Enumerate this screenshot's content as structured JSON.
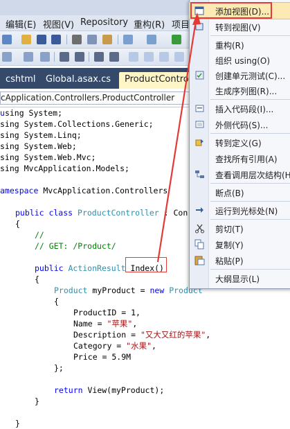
{
  "menubar": {
    "items": [
      "编辑(E)",
      "视图(V)",
      "Repository",
      "重构(R)",
      "项目"
    ]
  },
  "tabs": {
    "items": [
      {
        "label": "cshtml",
        "active": false
      },
      {
        "label": "Global.asax.cs",
        "active": false
      },
      {
        "label": "ProductControlle",
        "active": true
      }
    ]
  },
  "navbar": {
    "type_combo": "cApplication.Controllers.ProductController"
  },
  "code": {
    "usings": [
      "sing System;",
      "sing System.Collections.Generic;",
      "sing System.Linq;",
      "sing System.Web;",
      "sing System.Web.Mvc;",
      "sing MvcApplication.Models;"
    ],
    "ns_kw": "amespace",
    "ns_name": " MvcApplication.Controllers",
    "class_kw": "public class",
    "class_name": "ProductController",
    "class_rest": " : Con",
    "brace_open": "{",
    "brace_close": "}",
    "comment1": "//",
    "comment2": "// GET: /Product/",
    "method_kw": "public",
    "method_type": "ActionResult",
    "method_name": "Index()",
    "product_type": "Product",
    "var_decl": " myProduct = ",
    "new_kw": "new",
    "product_type2": " Product",
    "prop_id": "ProductID = 1,",
    "prop_name_lead": "Name = ",
    "prop_name_val": "\"苹果\"",
    "prop_name_tail": ",",
    "prop_desc_lead": "Description = ",
    "prop_desc_val": "\"又大又红的苹果\"",
    "prop_desc_tail": ",",
    "prop_cat_lead": "Category = ",
    "prop_cat_val": "\"水果\"",
    "prop_cat_tail": ",",
    "prop_price": "Price = 5.9M",
    "close_init": "};",
    "return_kw": "return",
    "return_rest": " View(myProduct);"
  },
  "context_menu": {
    "items": [
      {
        "label": "添加视图(D)...",
        "icon": "add-view-icon",
        "highlight": true
      },
      {
        "label": "转到视图(V)",
        "icon": "goto-view-icon"
      },
      {
        "label": "重构(R)",
        "icon": ""
      },
      {
        "label": "组织 using(O)",
        "icon": ""
      },
      {
        "label": "创建单元测试(C)...",
        "icon": "unit-test-icon"
      },
      {
        "label": "生成序列图(R)...",
        "icon": ""
      },
      {
        "label": "插入代码段(I)...",
        "icon": "snippet-icon"
      },
      {
        "label": "外侧代码(S)...",
        "icon": "surround-icon"
      },
      {
        "label": "转到定义(G)",
        "icon": "goto-def-icon"
      },
      {
        "label": "查找所有引用(A)",
        "icon": ""
      },
      {
        "label": "查看调用层次结构(H",
        "icon": "call-hierarchy-icon"
      },
      {
        "label": "断点(B)",
        "icon": ""
      },
      {
        "label": "运行到光标处(N)",
        "icon": "run-to-cursor-icon"
      },
      {
        "label": "剪切(T)",
        "icon": "cut-icon"
      },
      {
        "label": "复制(Y)",
        "icon": "copy-icon"
      },
      {
        "label": "粘贴(P)",
        "icon": "paste-icon"
      },
      {
        "label": "大纲显示(L)",
        "icon": ""
      }
    ]
  },
  "colors": {
    "annotation_red": "#e53935",
    "menu_highlight": "#fde9b4",
    "tab_strip": "#35496a",
    "active_tab": "#fff6c8"
  }
}
